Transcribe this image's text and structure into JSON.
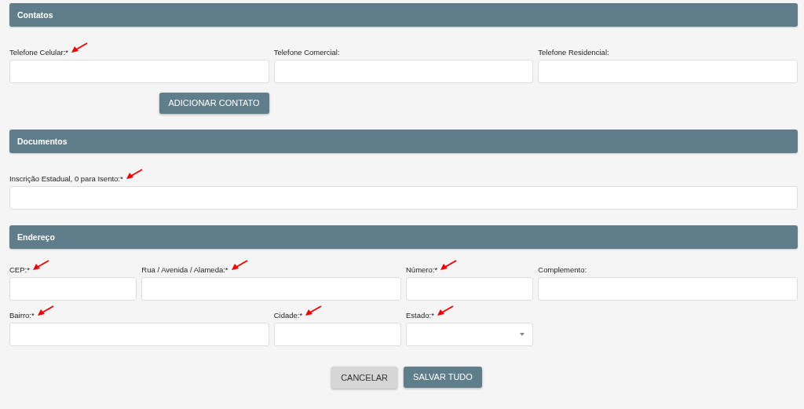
{
  "sections": [
    {
      "title": "Contatos",
      "fields": [
        {
          "label": "Telefone Celular:*",
          "kind": "input",
          "annotated": true
        },
        {
          "label": "Telefone Comercial:",
          "kind": "input",
          "annotated": false
        },
        {
          "label": "Telefone Residencial:",
          "kind": "input",
          "annotated": false
        }
      ],
      "button": "ADICIONAR CONTATO"
    },
    {
      "title": "Documentos",
      "fields": [
        {
          "label": "Inscrição Estadual, 0 para Isento:*",
          "kind": "input",
          "annotated": true
        }
      ]
    },
    {
      "title": "Endereço",
      "fields": [
        {
          "label": "CEP:*",
          "kind": "input",
          "annotated": true
        },
        {
          "label": "Rua / Avenida / Alameda:*",
          "kind": "input",
          "annotated": true
        },
        {
          "label": "Número:*",
          "kind": "input",
          "annotated": true
        },
        {
          "label": "Complemento:",
          "kind": "input",
          "annotated": false
        },
        {
          "label": "Bairro:*",
          "kind": "input",
          "annotated": true
        },
        {
          "label": "Cidade:*",
          "kind": "input",
          "annotated": true
        },
        {
          "label": "Estado:*",
          "kind": "select",
          "annotated": true
        }
      ]
    }
  ],
  "actions": [
    {
      "label": "CANCELAR",
      "kind": "secondary"
    },
    {
      "label": "SALVAR TUDO",
      "kind": "primary"
    }
  ]
}
